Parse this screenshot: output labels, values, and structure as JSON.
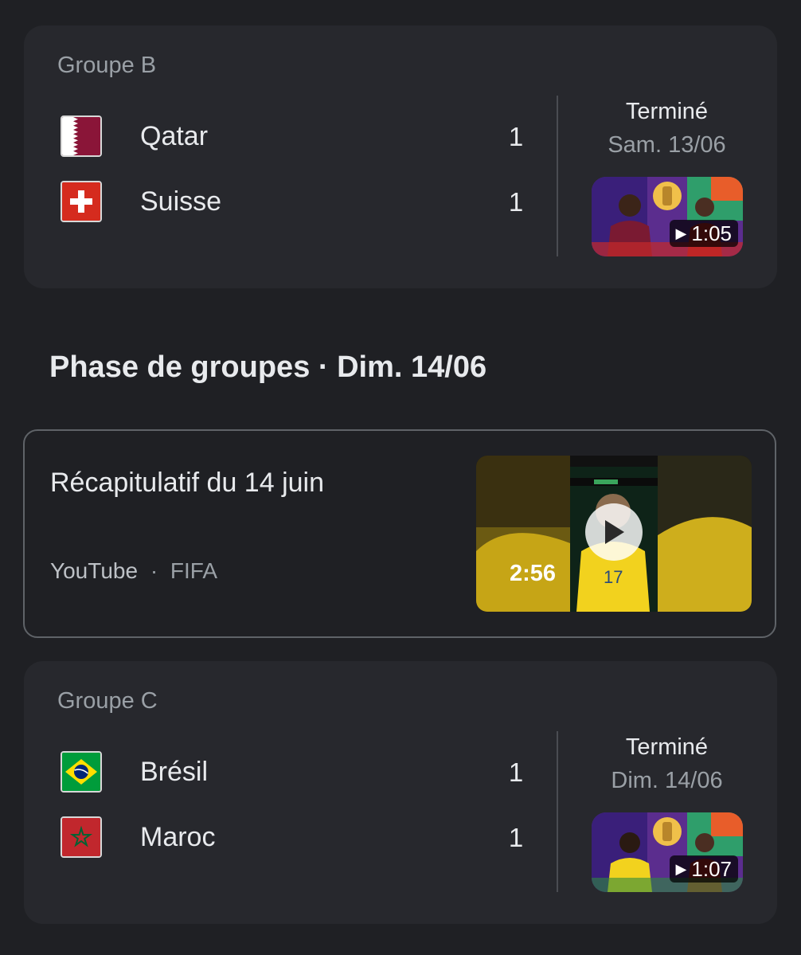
{
  "matches": [
    {
      "group": "Groupe B",
      "team1": {
        "name": "Qatar",
        "score": "1",
        "flag": "qatar-flag"
      },
      "team2": {
        "name": "Suisse",
        "score": "1",
        "flag": "switzerland-flag"
      },
      "status": "Terminé",
      "date": "Sam. 13/06",
      "video_duration": "1:05"
    },
    {
      "group": "Groupe C",
      "team1": {
        "name": "Brésil",
        "score": "1",
        "flag": "brazil-flag"
      },
      "team2": {
        "name": "Maroc",
        "score": "1",
        "flag": "morocco-flag"
      },
      "status": "Terminé",
      "date": "Dim. 14/06",
      "video_duration": "1:07"
    }
  ],
  "section_heading": "Phase de groupes · Dim. 14/06",
  "recap": {
    "title": "Récapitulatif du 14 juin",
    "source": "YouTube",
    "separator": "·",
    "channel": "FIFA",
    "duration": "2:56"
  },
  "colors": {
    "background": "#1f2024",
    "card": "#27282d",
    "text_primary": "#e8eaed",
    "text_secondary": "#9aa0a6",
    "qatar_maroon": "#8a1538",
    "swiss_red": "#d52b1e",
    "brazil_green": "#009c3b",
    "brazil_yellow": "#ffdf00",
    "morocco_red": "#c1272d"
  }
}
